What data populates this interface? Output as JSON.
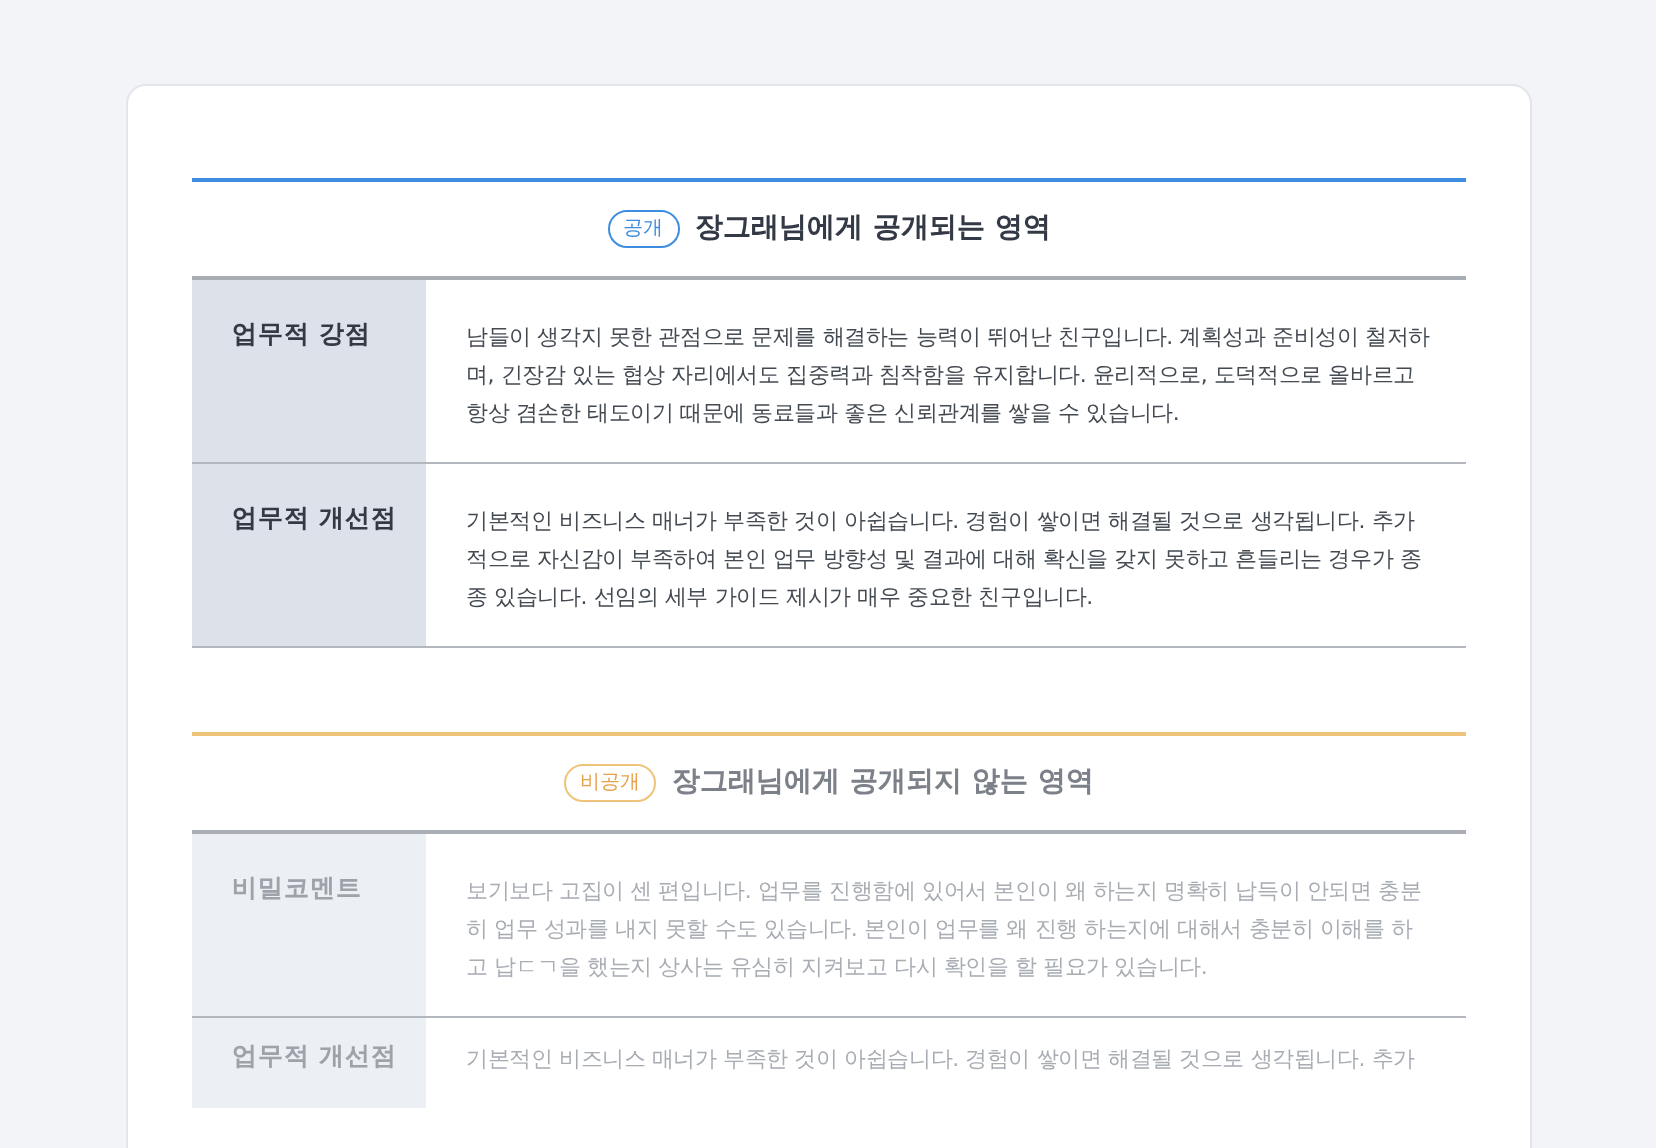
{
  "sections": [
    {
      "kind": "public",
      "badge": "공개",
      "title": "장그래님에게 공개되는 영역",
      "rows": [
        {
          "label": "업무적 강점",
          "text": "남들이 생각지 못한 관점으로 문제를 해결하는 능력이 뛰어난 친구입니다. 계획성과 준비성이 철저하며, 긴장감 있는 협상 자리에서도 집중력과 침착함을 유지합니다. 윤리적으로, 도덕적으로 올바르고 항상 겸손한 태도이기 때문에 동료들과 좋은 신뢰관계를 쌓을 수 있습니다."
        },
        {
          "label": "업무적 개선점",
          "text": "기본적인 비즈니스 매너가 부족한 것이 아쉽습니다. 경험이 쌓이면 해결될 것으로 생각됩니다. 추가적으로 자신감이 부족하여 본인 업무 방향성 및 결과에 대해 확신을 갖지 못하고 흔들리는 경우가 종종 있습니다. 선임의 세부 가이드 제시가 매우 중요한 친구입니다."
        }
      ]
    },
    {
      "kind": "private",
      "badge": "비공개",
      "title": "장그래님에게 공개되지 않는 영역",
      "rows": [
        {
          "label": "비밀코멘트",
          "text": "보기보다 고집이 센 편입니다. 업무를 진행함에 있어서 본인이 왜 하는지 명확히 납득이 안되면 충분히 업무 성과를 내지 못할 수도 있습니다. 본인이 업무를 왜 진행 하는지에 대해서 충분히 이해를 하고 납ㄷㄱ을 했는지 상사는 유심히 지켜보고 다시 확인을 할 필요가 있습니다."
        },
        {
          "label": "업무적 개선점",
          "text": "기본적인 비즈니스 매너가 부족한 것이 아쉽습니다. 경험이 쌓이면 해결될 것으로 생각됩니다. 추가"
        }
      ]
    }
  ]
}
